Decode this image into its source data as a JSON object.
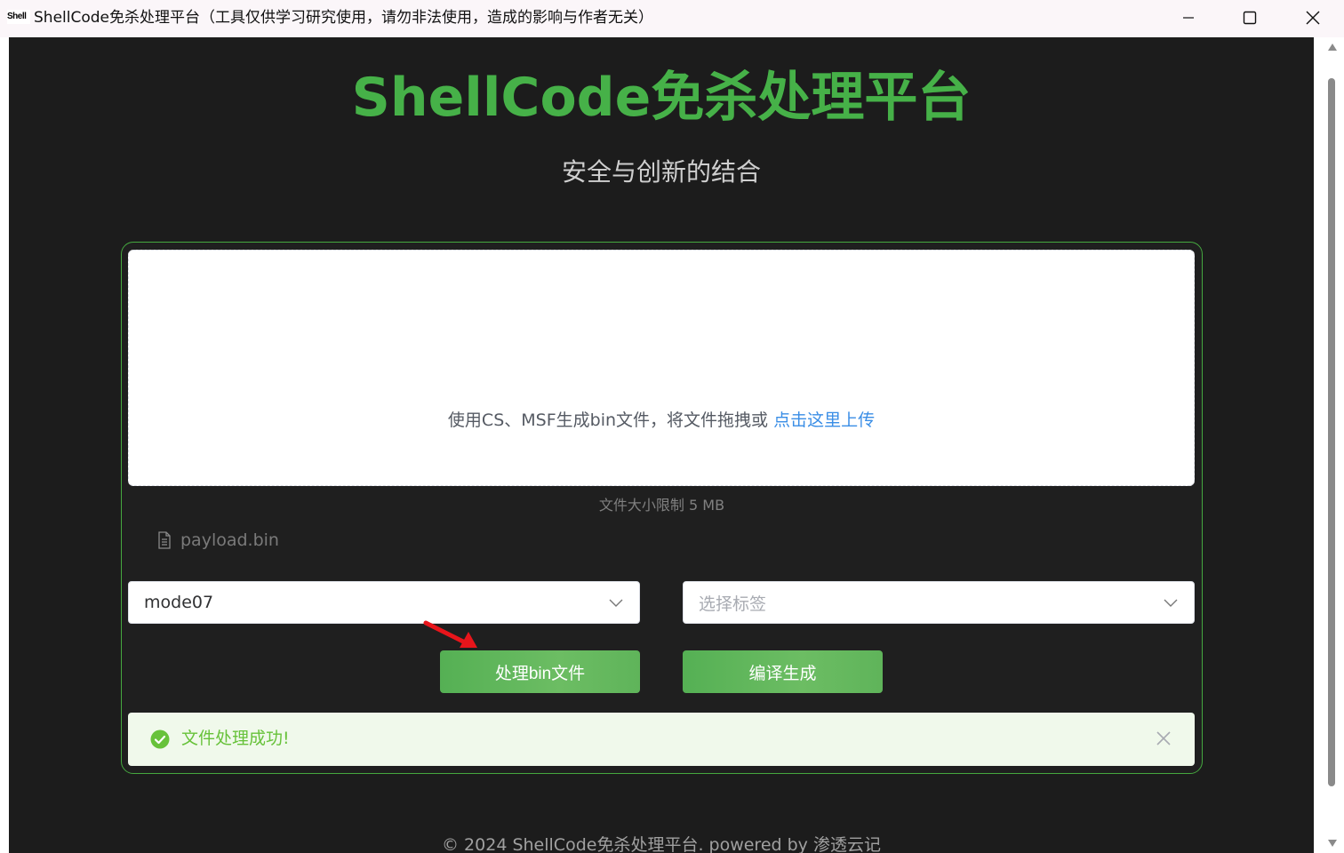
{
  "window": {
    "icon_text": "Shell",
    "title": "ShellCode免杀处理平台（工具仅供学习研究使用，请勿非法使用，造成的影响与作者无关）"
  },
  "header": {
    "title": "ShellCode免杀处理平台",
    "subtitle": "安全与创新的结合"
  },
  "upload": {
    "instruction": "使用CS、MSF生成bin文件，将文件拖拽或 ",
    "link_text": "点击这里上传",
    "size_limit": "文件大小限制 5 MB",
    "file_icon": "document-icon",
    "files": [
      "payload.bin"
    ]
  },
  "form": {
    "mode_select": {
      "value": "mode07"
    },
    "tag_select": {
      "placeholder": "选择标签"
    },
    "process_button": "处理bin文件",
    "compile_button": "编译生成"
  },
  "alert": {
    "type": "success",
    "message": "文件处理成功!",
    "icon": "check-circle-icon"
  },
  "footer": {
    "text": "© 2024 ShellCode免杀处理平台. powered by 渗透云记"
  },
  "colors": {
    "brand_green": "#46b148",
    "link_blue": "#3a8ee6",
    "success_text": "#67c23a",
    "background": "#1c1c1c"
  }
}
